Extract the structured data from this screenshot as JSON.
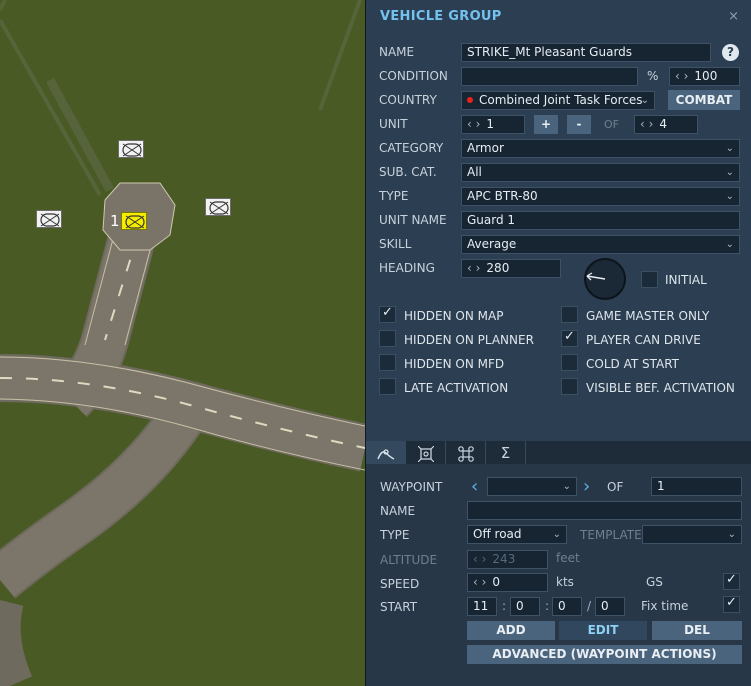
{
  "panel": {
    "title": "VEHICLE GROUP",
    "close_icon": "×",
    "help_label": "?",
    "name": {
      "label": "NAME",
      "value": "STRIKE_Mt Pleasant Guards"
    },
    "condition": {
      "label": "CONDITION",
      "value": "",
      "percent": "%",
      "amount": "100"
    },
    "country": {
      "label": "COUNTRY",
      "value": "Combined Joint Task Forces",
      "dot_color": "#e8231b",
      "combat_label": "COMBAT"
    },
    "unit": {
      "label": "UNIT",
      "value": "1",
      "plus": "+",
      "minus": "-",
      "of_label": "OF",
      "total": "4"
    },
    "category": {
      "label": "CATEGORY",
      "value": "Armor"
    },
    "subcat": {
      "label": "SUB. CAT.",
      "value": "All"
    },
    "type": {
      "label": "TYPE",
      "value": "APC BTR-80"
    },
    "unit_name": {
      "label": "UNIT NAME",
      "value": "Guard 1"
    },
    "skill": {
      "label": "SKILL",
      "value": "Average"
    },
    "heading": {
      "label": "HEADING",
      "value": "280",
      "initial_label": "INITIAL",
      "initial_checked": false
    },
    "checkboxes": [
      {
        "label": "HIDDEN ON MAP",
        "checked": true
      },
      {
        "label": "HIDDEN ON PLANNER",
        "checked": false
      },
      {
        "label": "HIDDEN ON MFD",
        "checked": false
      },
      {
        "label": "LATE ACTIVATION",
        "checked": false
      },
      {
        "label": "GAME MASTER ONLY",
        "checked": false
      },
      {
        "label": "PLAYER CAN DRIVE",
        "checked": true
      },
      {
        "label": "COLD AT START",
        "checked": false
      },
      {
        "label": "VISIBLE BEF. ACTIVATION",
        "checked": false
      }
    ]
  },
  "tabs": [
    {
      "icon": "route-icon"
    },
    {
      "icon": "target-icon"
    },
    {
      "icon": "command-icon"
    },
    {
      "icon": "sigma-icon",
      "glyph": "Σ"
    }
  ],
  "waypoint": {
    "label": "WAYPOINT",
    "value": "",
    "of_label": "OF",
    "total": "1",
    "name_label": "NAME",
    "name_value": "",
    "type_label": "TYPE",
    "type_value": "Off road",
    "template_label": "TEMPLATE",
    "template_value": "",
    "altitude_label": "ALTITUDE",
    "altitude_value": "243",
    "altitude_unit": "feet",
    "speed_label": "SPEED",
    "speed_value": "0",
    "speed_unit": "kts",
    "gs_label": "GS",
    "gs_checked": true,
    "start_label": "START",
    "start_h": "11",
    "start_m": "0",
    "start_s": "0",
    "start_d": "0",
    "start_sep_colon": ":",
    "start_sep_slash": "/",
    "fixtime_label": "Fix time",
    "fixtime_checked": true,
    "add_label": "ADD",
    "edit_label": "EDIT",
    "del_label": "DEL",
    "advanced_label": "ADVANCED (WAYPOINT ACTIONS)"
  },
  "map": {
    "selected_unit_number": "1",
    "selected_color": "#f5ec00"
  }
}
